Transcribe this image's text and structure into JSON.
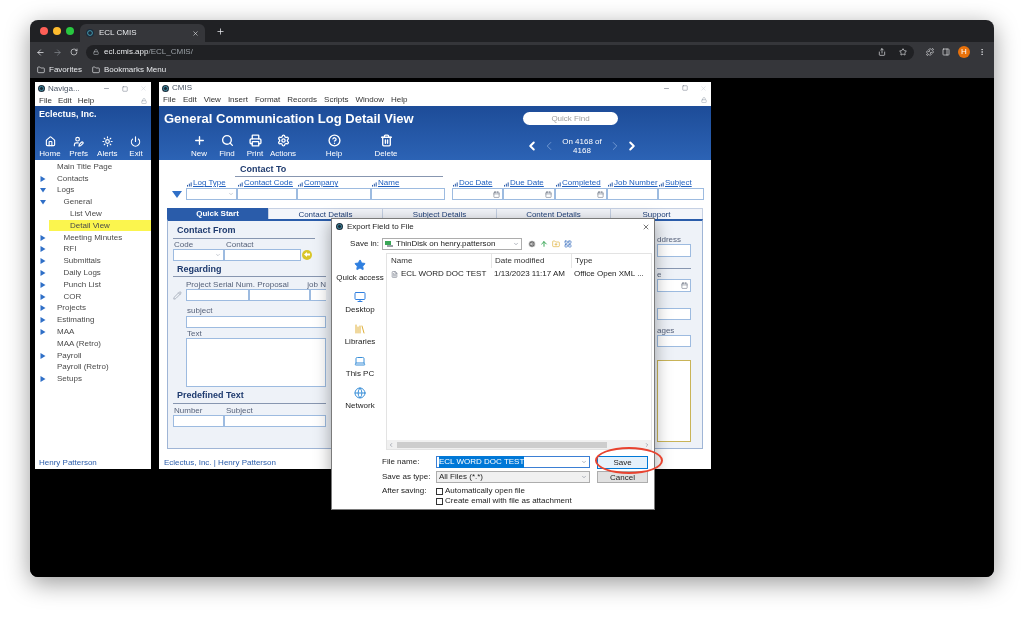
{
  "browser": {
    "tab_title": "ECL CMIS",
    "url_host": "ecl.cmis.app",
    "url_path": "/ECL_CMIS/",
    "avatar": "H",
    "bookmarks": [
      "Favorites",
      "Bookmarks Menu"
    ]
  },
  "nav_window": {
    "title": "Naviga...",
    "menu": [
      "File",
      "Edit",
      "Help"
    ],
    "company": "Eclectus, Inc.",
    "toolbar": [
      {
        "label": "Home",
        "kind": "home"
      },
      {
        "label": "Prefs",
        "kind": "prefs"
      },
      {
        "label": "Alerts",
        "kind": "alerts"
      },
      {
        "label": "Exit",
        "kind": "exit"
      }
    ],
    "tree": [
      {
        "label": "Main Title Page",
        "kind": "leaf",
        "selected": false
      },
      {
        "label": "Contacts",
        "kind": "folder",
        "expanded": false,
        "selected": false
      },
      {
        "label": "Logs",
        "kind": "folder",
        "expanded": true,
        "selected": false,
        "children": [
          {
            "label": "General",
            "kind": "folder",
            "expanded": true,
            "selected": false,
            "children": [
              {
                "label": "List View",
                "kind": "leaf",
                "selected": false
              },
              {
                "label": "Detail View",
                "kind": "leaf",
                "selected": true
              }
            ]
          },
          {
            "label": "Meeting Minutes",
            "kind": "folder",
            "expanded": false,
            "selected": false
          },
          {
            "label": "RFI",
            "kind": "folder",
            "expanded": false,
            "selected": false
          },
          {
            "label": "Submittals",
            "kind": "folder",
            "expanded": false,
            "selected": false
          },
          {
            "label": "Daily Logs",
            "kind": "folder",
            "expanded": false,
            "selected": false
          },
          {
            "label": "Punch List",
            "kind": "folder",
            "expanded": false,
            "selected": false
          },
          {
            "label": "COR",
            "kind": "folder",
            "expanded": false,
            "selected": false
          }
        ]
      },
      {
        "label": "Projects",
        "kind": "folder",
        "expanded": false,
        "selected": false
      },
      {
        "label": "Estimating",
        "kind": "folder",
        "expanded": false,
        "selected": false
      },
      {
        "label": "MAA",
        "kind": "folder",
        "expanded": false,
        "selected": false
      },
      {
        "label": "MAA (Retro)",
        "kind": "leaf",
        "selected": false
      },
      {
        "label": "Payroll",
        "kind": "folder",
        "expanded": false,
        "selected": false
      },
      {
        "label": "Payroll (Retro)",
        "kind": "leaf",
        "selected": false
      },
      {
        "label": "Setups",
        "kind": "folder",
        "expanded": false,
        "selected": false
      }
    ],
    "user": "Henry Patterson"
  },
  "cmis_window": {
    "title": "CMIS",
    "menu": [
      "File",
      "Edit",
      "View",
      "Insert",
      "Format",
      "Records",
      "Scripts",
      "Window",
      "Help"
    ],
    "heading": "General Communication Log Detail View",
    "quick_find": {
      "placeholder": "Quick Find"
    },
    "toolbar": [
      {
        "label": "New",
        "kind": "new"
      },
      {
        "label": "Find",
        "kind": "find"
      },
      {
        "label": "Print",
        "kind": "print"
      },
      {
        "label": "Actions",
        "kind": "actions"
      },
      {
        "label": "Help",
        "kind": "help"
      },
      {
        "label": "Delete",
        "kind": "delete"
      }
    ],
    "record_position": "On 4168 of 4168",
    "contact_to": "Contact To",
    "header_fields": [
      {
        "label": "Log Type",
        "kind": "dropdown"
      },
      {
        "label": "Contact Code",
        "kind": "text"
      },
      {
        "label": "Company",
        "kind": "text"
      },
      {
        "label": "Name",
        "kind": "text"
      },
      {
        "label": "Doc Date",
        "kind": "date"
      },
      {
        "label": "Due Date",
        "kind": "date"
      },
      {
        "label": "Completed",
        "kind": "date"
      },
      {
        "label": "Job Number",
        "kind": "text"
      },
      {
        "label": "Subject",
        "kind": "text"
      }
    ],
    "tabs": [
      {
        "label": "Quick Start",
        "selected": true
      },
      {
        "label": "Contact Details",
        "selected": false
      },
      {
        "label": "Subject Details",
        "selected": false
      },
      {
        "label": "Content Details",
        "selected": false
      },
      {
        "label": "Support",
        "selected": false
      }
    ],
    "contact_from": {
      "title": "Contact From",
      "code_label": "Code",
      "contact_label": "Contact"
    },
    "regarding": {
      "title": "Regarding",
      "field_labels": [
        "Project Serial Num.",
        "Proposal",
        "job N"
      ],
      "subject_label": "subject",
      "text_label": "Text"
    },
    "predefined_text": {
      "title": "Predefined Text",
      "number_label": "Number",
      "subject_label": "Subject"
    },
    "right_labels": [
      "ddress",
      "e",
      "ages"
    ],
    "footer": "Eclectus, Inc. | Henry Patterson"
  },
  "dialog": {
    "title": "Export Field to File",
    "save_in_label": "Save in:",
    "save_in": "ThinDisk on henry.patterson",
    "places": [
      {
        "label": "Quick access",
        "kind": "star"
      },
      {
        "label": "Desktop",
        "kind": "desktop"
      },
      {
        "label": "Libraries",
        "kind": "libraries"
      },
      {
        "label": "This PC",
        "kind": "pc"
      },
      {
        "label": "Network",
        "kind": "network"
      }
    ],
    "columns": [
      "Name",
      "Date modified",
      "Type"
    ],
    "files": [
      {
        "name": "ECL WORD DOC TEST",
        "modified": "1/13/2023 11:17 AM",
        "type": "Office Open XML ..."
      }
    ],
    "file_name_label": "File name:",
    "file_name": {
      "value": "ECL WORD DOC TEST",
      "selected": true
    },
    "save_as_type_label": "Save as type:",
    "save_as_type": "All Files (*.*)",
    "after_saving_label": "After saving:",
    "options": [
      {
        "label": "Automatically open file",
        "checked": false
      },
      {
        "label": "Create email with file as attachment",
        "checked": false
      }
    ],
    "buttons": [
      {
        "label": "Save",
        "kind": "primary"
      },
      {
        "label": "Cancel",
        "kind": "secondary"
      }
    ]
  }
}
